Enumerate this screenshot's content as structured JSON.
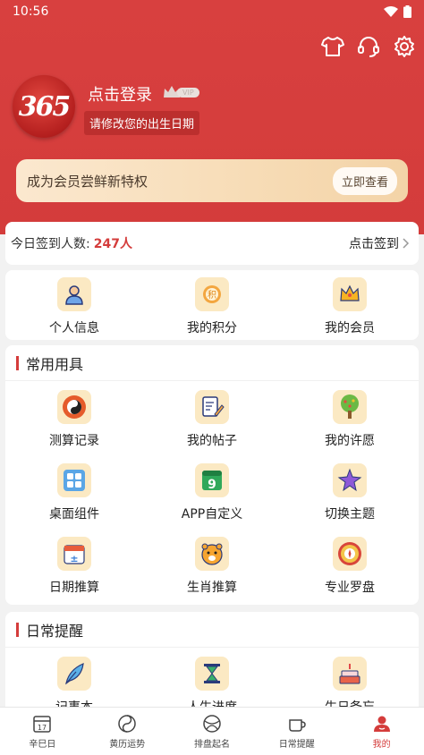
{
  "status": {
    "time": "10:56"
  },
  "profile": {
    "avatar_text": "365",
    "login_label": "点击登录",
    "vip_tag": "VIP",
    "birth_hint": "请修改您的出生日期"
  },
  "vip_banner": {
    "text": "成为会员尝鲜新特权",
    "button": "立即查看"
  },
  "checkin": {
    "label": "今日签到人数:",
    "count": "247人",
    "action": "点击签到"
  },
  "quick": [
    {
      "label": "个人信息",
      "icon": "person-icon"
    },
    {
      "label": "我的积分",
      "icon": "points-icon"
    },
    {
      "label": "我的会员",
      "icon": "crown-icon"
    }
  ],
  "tools": {
    "title": "常用用具",
    "items": [
      {
        "label": "测算记录",
        "icon": "taiji-icon"
      },
      {
        "label": "我的帖子",
        "icon": "post-icon"
      },
      {
        "label": "我的许愿",
        "icon": "wish-tree-icon"
      },
      {
        "label": "桌面组件",
        "icon": "widget-icon"
      },
      {
        "label": "APP自定义",
        "icon": "calendar-9-icon"
      },
      {
        "label": "切换主题",
        "icon": "theme-star-icon"
      },
      {
        "label": "日期推算",
        "icon": "date-calc-icon"
      },
      {
        "label": "生肖推算",
        "icon": "tiger-icon"
      },
      {
        "label": "专业罗盘",
        "icon": "compass-icon"
      }
    ]
  },
  "reminders": {
    "title": "日常提醒",
    "items": [
      {
        "label": "记事本",
        "icon": "feather-icon"
      },
      {
        "label": "人生进度",
        "icon": "hourglass-icon"
      },
      {
        "label": "生日备忘",
        "icon": "cake-icon"
      }
    ]
  },
  "tabs": [
    {
      "label": "辛巳日",
      "icon": "calendar-17-icon",
      "day": "17"
    },
    {
      "label": "黄历运势",
      "icon": "yinyang-icon"
    },
    {
      "label": "排盘起名",
      "icon": "globe-icon"
    },
    {
      "label": "日常提醒",
      "icon": "cup-icon"
    },
    {
      "label": "我的",
      "icon": "user-icon"
    }
  ],
  "colors": {
    "brand": "#d43c3b",
    "tile_bg": "#fbe9c3",
    "vip_gold": "#f7dcb6"
  }
}
